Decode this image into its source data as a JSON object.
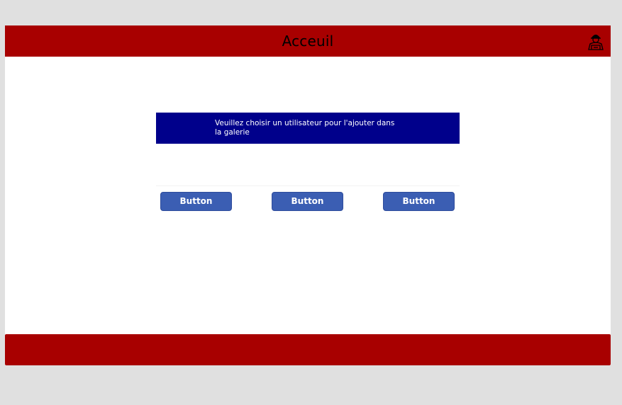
{
  "header": {
    "title": "Acceuil",
    "user_icon": "user-icon"
  },
  "banner": {
    "text": "Veuillez choisir un utilisateur pour l'ajouter dans la galerie"
  },
  "gallery": {
    "buttons": [
      {
        "label": "Button"
      },
      {
        "label": "Button"
      },
      {
        "label": "Button"
      }
    ]
  },
  "colors": {
    "header_bg": "#a80000",
    "banner_bg": "#00008b",
    "button_bg": "#3b5eb3",
    "page_bg": "#e0e0e0"
  }
}
